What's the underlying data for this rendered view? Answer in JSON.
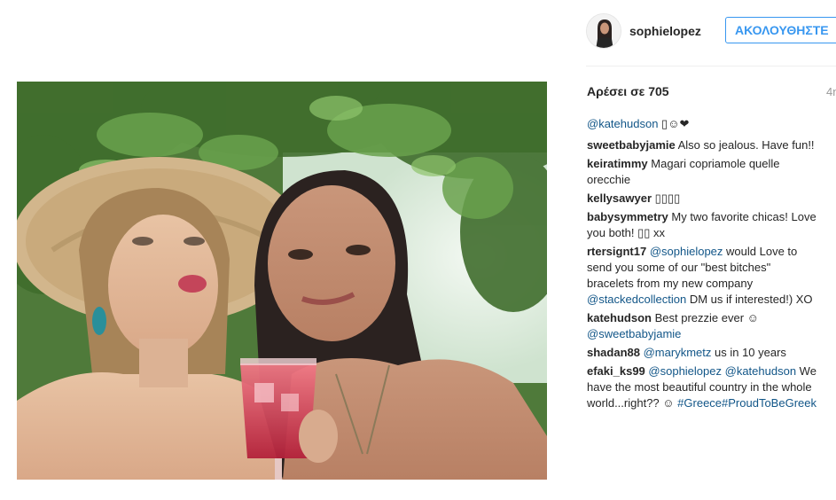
{
  "header": {
    "username": "sophielopez",
    "follow_label": "ΑΚΟΛΟΥΘΗΣΤΕ"
  },
  "post": {
    "likes": "Αρέσει σε 705",
    "time_ago": "4η"
  },
  "caption": {
    "mention": "@katehudson",
    "emoji": "▯☺❤"
  },
  "comments": [
    {
      "user": "sweetbabyjamie",
      "text": "Also so jealous. Have fun!!"
    },
    {
      "user": "keiratimmy",
      "text": "Magari copriamole quelle orecchie"
    },
    {
      "user": "kellysawyer",
      "text": "▯▯▯▯"
    },
    {
      "user": "babysymmetry",
      "text": "My two favorite chicas! Love you both! ▯▯ xx"
    },
    {
      "user": "rtersignt17",
      "mention1": "@sophielopez",
      "text1": "would Love to send you some of our \"best bitches\" bracelets from my new company",
      "mention2": "@stackedcollection",
      "text2": "DM us if interested!) XO"
    },
    {
      "user": "katehudson",
      "text": "Best prezzie ever ☺",
      "mention": "@sweetbabyjamie"
    },
    {
      "user": "shadan88",
      "mention": "@marykmetz",
      "text": "us in 10 years"
    },
    {
      "user": "efaki_ks99",
      "mention1": "@sophielopez",
      "mention2": "@katehudson",
      "text": "We have the most beautiful country in the whole world...right?? ☺",
      "tags": "#Greece#ProudToBeGreek"
    }
  ],
  "colors": {
    "link": "#125688",
    "follow_blue": "#3897f0",
    "text": "#262626",
    "muted": "#999999"
  },
  "icons": {
    "avatar": "user-avatar"
  }
}
